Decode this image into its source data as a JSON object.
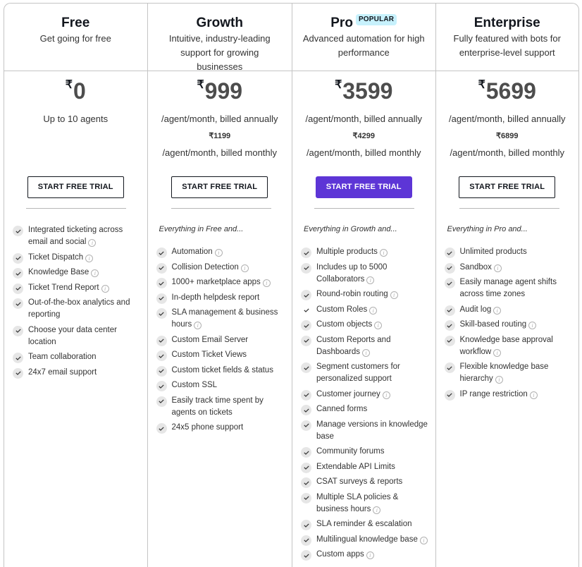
{
  "currency_symbol": "₹",
  "colors": {
    "primary_button": "#5d35d6",
    "popular_badge": "#c7f1fc",
    "border": "#c4c4c4"
  },
  "plans": [
    {
      "name": "Free",
      "tagline": "Get going for free",
      "price": "0",
      "price_note": "Up to 10 agents",
      "cta": "START FREE TRIAL",
      "features_intro": "",
      "features": [
        {
          "text": "Integrated ticketing across email and social",
          "info": true
        },
        {
          "text": "Ticket Dispatch",
          "info": true
        },
        {
          "text": "Knowledge Base",
          "info": true
        },
        {
          "text": "Ticket Trend Report",
          "info": true
        },
        {
          "text": "Out-of-the-box analytics and reporting",
          "info": false
        },
        {
          "text": "Choose your data center location",
          "info": false
        },
        {
          "text": "Team collaboration",
          "info": false
        },
        {
          "text": "24x7 email support",
          "info": false
        }
      ]
    },
    {
      "name": "Growth",
      "tagline": "Intuitive, industry-leading support for growing businesses",
      "price": "999",
      "billed_annually": "/agent/month, billed annually",
      "monthly_price": "₹1199",
      "billed_monthly": "/agent/month, billed monthly",
      "cta": "START FREE TRIAL",
      "features_intro": "Everything in Free and...",
      "features": [
        {
          "text": "Automation",
          "info": true
        },
        {
          "text": "Collision Detection",
          "info": true
        },
        {
          "text": "1000+ marketplace apps",
          "info": true
        },
        {
          "text": "In-depth helpdesk report",
          "info": false
        },
        {
          "text": "SLA management & business hours",
          "info": true
        },
        {
          "text": "Custom Email Server",
          "info": false
        },
        {
          "text": "Custom Ticket Views",
          "info": false
        },
        {
          "text": "Custom ticket fields & status",
          "info": false
        },
        {
          "text": "Custom SSL",
          "info": false
        },
        {
          "text": "Easily track time spent by agents on tickets",
          "info": false
        },
        {
          "text": "24x5 phone support",
          "info": false
        }
      ]
    },
    {
      "name": "Pro",
      "badge": "POPULAR",
      "tagline": "Advanced automation for high performance",
      "price": "3599",
      "billed_annually": "/agent/month, billed annually",
      "monthly_price": "₹4299",
      "billed_monthly": "/agent/month, billed monthly",
      "cta": "START FREE TRIAL",
      "features_intro": "Everything in Growth and...",
      "features": [
        {
          "text": "Multiple products",
          "info": true
        },
        {
          "text": "Includes up to 5000 Collaborators",
          "info": true
        },
        {
          "text": "Round-robin routing",
          "info": true
        },
        {
          "text": "Custom Roles",
          "info": true,
          "plain_check": true
        },
        {
          "text": "Custom objects",
          "info": true
        },
        {
          "text": "Custom Reports and Dashboards",
          "info": true
        },
        {
          "text": "Segment customers for personalized support",
          "info": false
        },
        {
          "text": "Customer journey",
          "info": true
        },
        {
          "text": "Canned forms",
          "info": false
        },
        {
          "text": "Manage versions in knowledge base",
          "info": false
        },
        {
          "text": "Community forums",
          "info": false
        },
        {
          "text": "Extendable API Limits",
          "info": false
        },
        {
          "text": "CSAT surveys & reports",
          "info": false
        },
        {
          "text": "Multiple SLA policies & business hours",
          "info": true
        },
        {
          "text": "SLA reminder & escalation",
          "info": false
        },
        {
          "text": "Multilingual knowledge base",
          "info": true
        },
        {
          "text": "Custom apps",
          "info": true
        }
      ]
    },
    {
      "name": "Enterprise",
      "tagline": "Fully featured with bots for enterprise-level support",
      "price": "5699",
      "billed_annually": "/agent/month, billed annually",
      "monthly_price": "₹6899",
      "billed_monthly": "/agent/month, billed monthly",
      "cta": "START FREE TRIAL",
      "features_intro": "Everything in Pro and...",
      "features": [
        {
          "text": "Unlimited products",
          "info": false
        },
        {
          "text": "Sandbox",
          "info": true
        },
        {
          "text": "Easily manage agent shifts across time zones",
          "info": false
        },
        {
          "text": "Audit log",
          "info": true
        },
        {
          "text": "Skill-based routing",
          "info": true
        },
        {
          "text": "Knowledge base approval workflow",
          "info": true
        },
        {
          "text": "Flexible knowledge base hierarchy",
          "info": true
        },
        {
          "text": "IP range restriction",
          "info": true
        }
      ]
    }
  ]
}
